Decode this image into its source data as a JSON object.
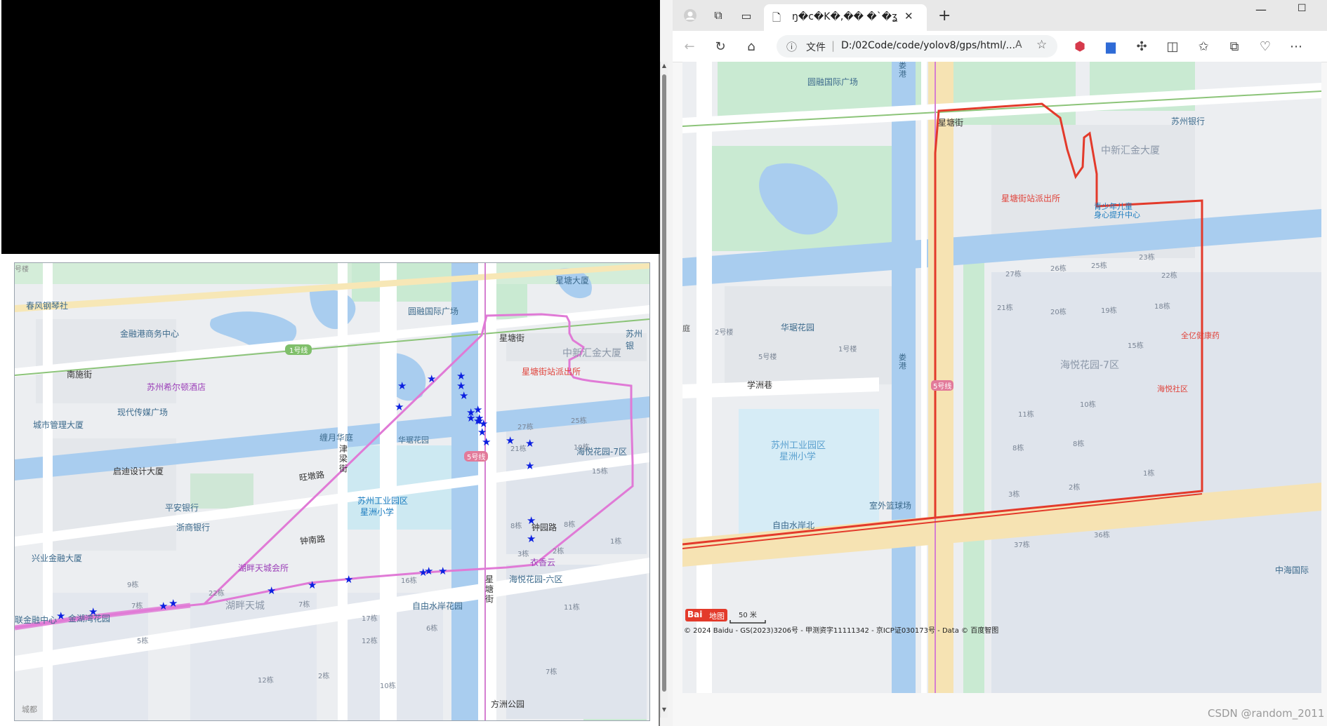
{
  "left_map": {
    "labels": {
      "chunfeng": "春风钢琴社",
      "jinrong_gang": "金融港商务中心",
      "nanshi": "南施街",
      "line1": "1号线",
      "xierdun": "苏州希尔顿酒店",
      "xiandai": "现代传媒广场",
      "chengshi": "城市管理大厦",
      "qidi": "启迪设计大厦",
      "pingan": "平安银行",
      "zheshang": "浙商银行",
      "xinglian": "兴业金融大厦",
      "lianjinrong": "联金融中心",
      "yuanrong": "圆融国际广场",
      "xingtang_dasha": "星塘大厦",
      "xingtangjie": "星塘街",
      "zhongxin_huijin": "中新汇金大厦",
      "suzhouyh": "苏州银",
      "paichusuo": "星塘街站派出所",
      "chanyue": "缠月华庭",
      "huaqi": "华琚花园",
      "wangdun": "旺墩路",
      "jinliang": "津梁街",
      "xingzhou": "苏州工业园区\n星洲小学",
      "xingzhou_l1": "苏州工业园区",
      "xingzhou_l2": "星洲小学",
      "line5": "5号线",
      "haiyue7": "海悦花园-7区",
      "zhongyuan_lu": "钟园路",
      "zhongnan_lu": "钟南路",
      "huipan_hui": "湖畔天城会所",
      "huipan": "湖畔天城",
      "jinhu": "金湖湾花园",
      "yixiangyun": "衣香云",
      "haiyue6": "海悦花园-六区",
      "zishui": "自由水岸花园",
      "fangzhou": "方洲公园",
      "xingtang_jie_v": "星塘街",
      "b27": "27栋",
      "b25": "25栋",
      "b21": "21栋",
      "b19": "19栋",
      "b15": "15栋",
      "b8a": "8栋",
      "b8b": "8栋",
      "b1": "1栋",
      "b3": "3栋",
      "b2": "2栋",
      "b16": "16栋",
      "b17": "17栋",
      "b6": "6栋",
      "b12": "12栋",
      "b9": "9栋",
      "b7a": "7栋",
      "b22": "22栋",
      "b7b": "7栋",
      "b5": "5栋",
      "b11": "11栋",
      "b10": "10栋",
      "b12b": "12栋",
      "b2b": "2栋",
      "b7c": "7栋",
      "chengdu": "城都",
      "haonan": "号楼"
    }
  },
  "browser": {
    "tab_title": "ŋ�c�K�,�� �`�ʓ�ʒ�",
    "address_prefix": "文件",
    "address_url": "D:/02Code/code/yolov8/gps/html/...",
    "read_aloud": "Á",
    "icons": [
      "profile-icon",
      "workspaces-icon",
      "tab-actions-icon",
      "page-icon",
      "close-icon",
      "plus-icon",
      "back-icon",
      "refresh-icon",
      "home-icon",
      "info-icon",
      "favorite-icon",
      "extension-icon",
      "split-icon",
      "collections-icon",
      "more-icon"
    ]
  },
  "right_map": {
    "labels": {
      "yuanrong": "圆融国际广场",
      "xingtangjie": "星塘街",
      "suzhou_bank": "苏州银行",
      "zhongxin": "中新汇金大厦",
      "paichusuo": "星塘街站派出所",
      "qingshaonian_l1": "青少年儿童",
      "qingshaonian_l2": "身心提升中心",
      "b23": "23栋",
      "b27": "27栋",
      "b26": "26栋",
      "b25": "25栋",
      "b22": "22栋",
      "b21": "21栋",
      "b20": "20栋",
      "b19": "19栋",
      "b18": "18栋",
      "b15": "15栋",
      "b11": "11栋",
      "b10": "10栋",
      "b8": "8栋",
      "b8b": "8栋",
      "b3": "3栋",
      "b2": "2栋",
      "b1": "1栋",
      "b36": "36栋",
      "b37": "37栋",
      "haiyue7": "海悦花园-7区",
      "haiyue_sq": "海悦社区",
      "quanyi": "全亿健康药",
      "huaqi": "华琚花园",
      "b2hao": "2号楼",
      "b5hao": "5号楼",
      "b1hao": "1号楼",
      "xuezhou": "学洲巷",
      "xingzhou_l1": "苏州工业园区",
      "xingzhou_l2": "星洲小学",
      "shiwai": "室外篮球场",
      "ziyou": "自由水岸北",
      "zhonghai": "中海国际",
      "lougang": "娄港",
      "lougang2": "娄港",
      "line5": "5号线",
      "ting": "庭",
      "scale": "50 米",
      "copyright": "© 2024 Baidu - GS(2023)3206号 - 甲测资字11111342 - 京ICP证030173号 - Data © 百度智图",
      "baidu_logo": "Bai",
      "baidu_logo2": "地图"
    }
  },
  "watermark": "CSDN @random_2011"
}
